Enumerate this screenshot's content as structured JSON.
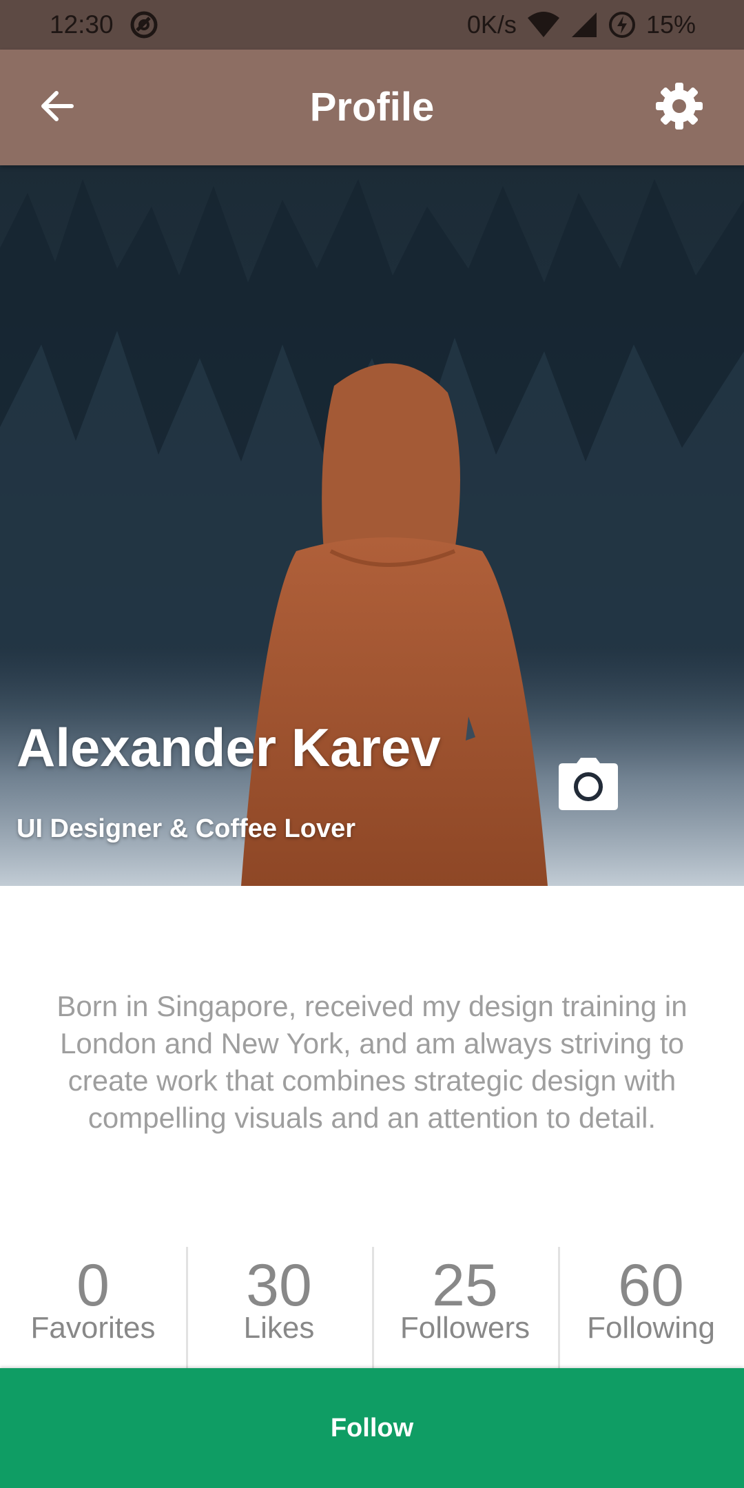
{
  "status_bar": {
    "time": "12:30",
    "network_speed": "0K/s",
    "battery": "15%",
    "icons": [
      "sync-icon",
      "wifi-icon",
      "cell-signal-icon",
      "battery-charging-icon"
    ]
  },
  "app_bar": {
    "title": "Profile",
    "back_icon": "arrow-back-icon",
    "settings_icon": "gear-icon",
    "background": "#8d6e63"
  },
  "profile": {
    "name": "Alexander Karev",
    "tagline": "UI Designer & Coffee Lover",
    "camera_icon": "camera-icon",
    "bio": "Born in Singapore, received my design training in London and New York, and am always striving to create work that combines strategic design with compelling visuals and an attention to detail."
  },
  "stats": [
    {
      "value": "0",
      "label": "Favorites"
    },
    {
      "value": "30",
      "label": "Likes"
    },
    {
      "value": "25",
      "label": "Followers"
    },
    {
      "value": "60",
      "label": "Following"
    }
  ],
  "follow_button": {
    "label": "Follow",
    "color": "#0f9d64"
  }
}
